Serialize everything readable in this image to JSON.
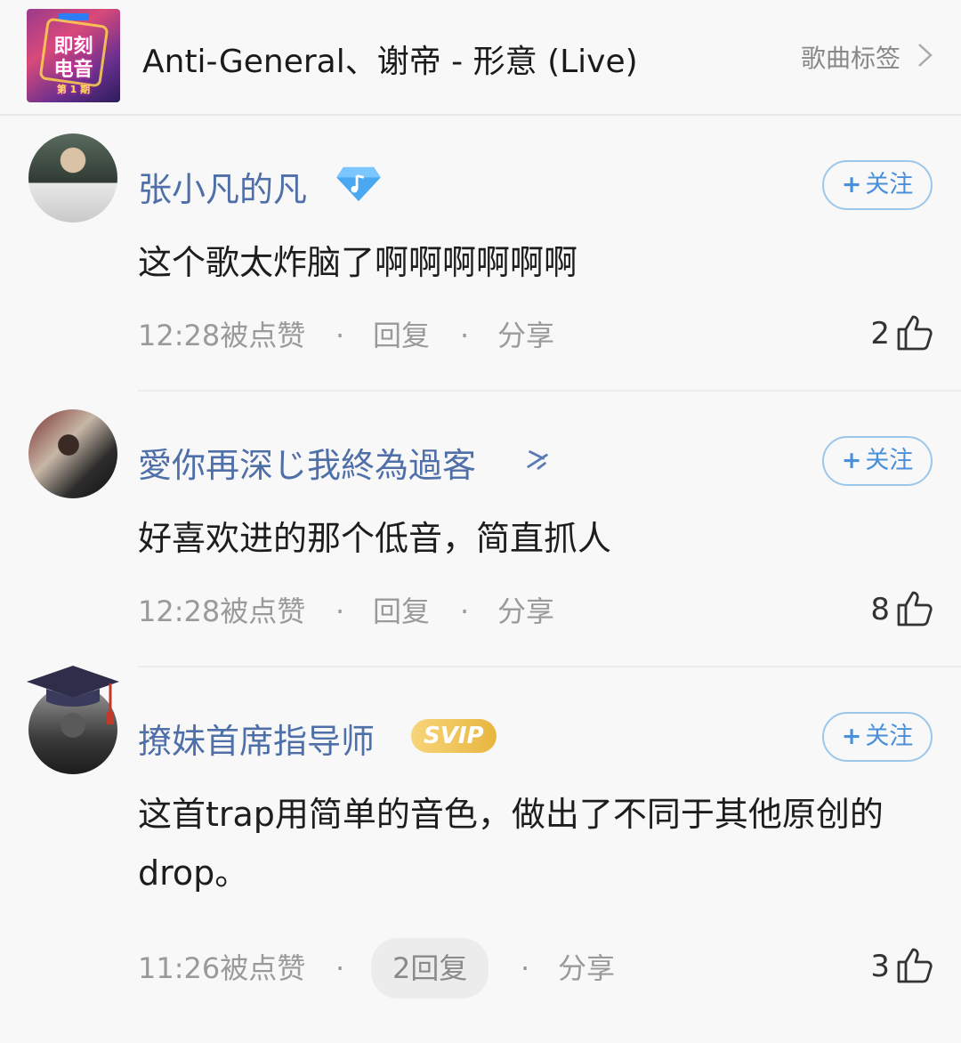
{
  "header": {
    "cover_line1": "即刻",
    "cover_line2": "电音",
    "cover_line3": "第 1 期",
    "song_title": "Anti-General、谢帝 - 形意 (Live)",
    "tags_link": "歌曲标签"
  },
  "comments": [
    {
      "user": "张小凡的凡",
      "badge": "music-diamond-icon",
      "follow": "关注",
      "text": "这个歌太炸脑了啊啊啊啊啊啊",
      "time": "12:28被点赞",
      "reply": "回复",
      "share": "分享",
      "likes": "2"
    },
    {
      "user": "愛你再深じ我終為過客",
      "badge": "decor-mark-icon",
      "follow": "关注",
      "text": "好喜欢进的那个低音，简直抓人",
      "time": "12:28被点赞",
      "reply": "回复",
      "share": "分享",
      "likes": "8"
    },
    {
      "user": "撩妹首席指导师",
      "badge": "SVIP",
      "follow": "关注",
      "text": "这首trap用简单的音色，做出了不同于其他原创的drop。",
      "time": "11:26被点赞",
      "reply": "2回复",
      "share": "分享",
      "likes": "3"
    }
  ],
  "colors": {
    "username": "#4f6fa8",
    "follow": "#4a90d9",
    "meta": "#9a9a9a",
    "svip": "#e8b640"
  }
}
